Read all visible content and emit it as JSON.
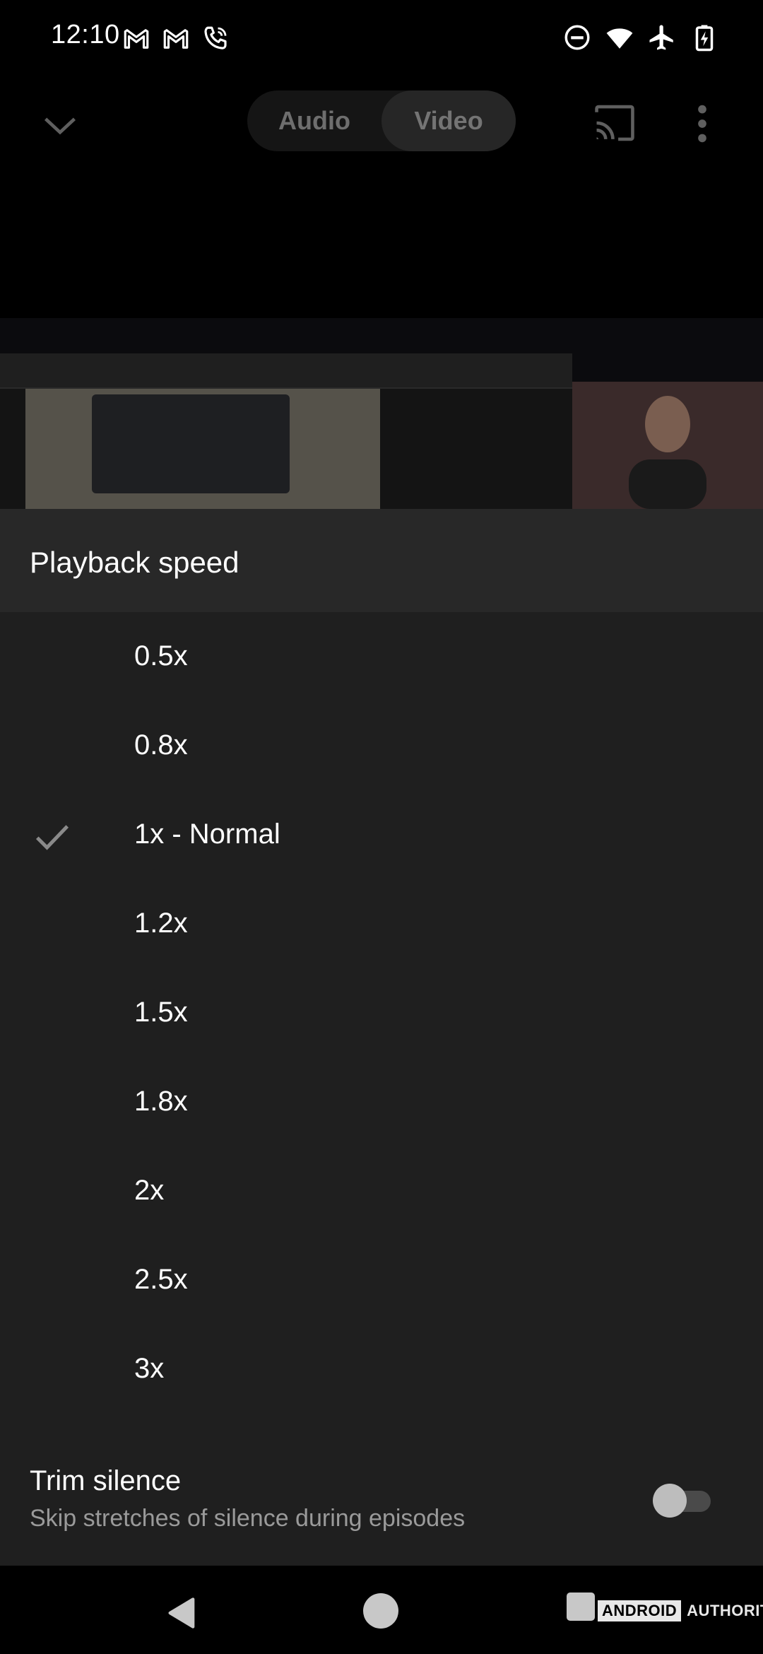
{
  "status_bar": {
    "time": "12:10",
    "left_icons": [
      "gmail-icon",
      "gmail-icon",
      "wifi-calling-icon"
    ],
    "right_icons": [
      "do-not-disturb-icon",
      "wifi-icon",
      "airplane-mode-icon",
      "battery-charging-icon"
    ]
  },
  "top_bar": {
    "collapse_icon": "chevron-down-icon",
    "tabs": [
      {
        "label": "Audio",
        "selected": false
      },
      {
        "label": "Video",
        "selected": true
      }
    ],
    "cast_icon": "cast-icon",
    "more_icon": "more-vert-icon"
  },
  "sheet": {
    "title": "Playback speed",
    "speeds": [
      {
        "label": "0.5x",
        "selected": false
      },
      {
        "label": "0.8x",
        "selected": false
      },
      {
        "label": "1x - Normal",
        "selected": true
      },
      {
        "label": "1.2x",
        "selected": false
      },
      {
        "label": "1.5x",
        "selected": false
      },
      {
        "label": "1.8x",
        "selected": false
      },
      {
        "label": "2x",
        "selected": false
      },
      {
        "label": "2.5x",
        "selected": false
      },
      {
        "label": "3x",
        "selected": false
      }
    ],
    "trim_silence": {
      "title": "Trim silence",
      "subtitle": "Skip stretches of silence during episodes",
      "enabled": false
    }
  },
  "nav_bar": {
    "icons": [
      "back-icon",
      "home-icon",
      "recents-icon"
    ]
  },
  "watermark": {
    "brand": "ANDROID",
    "suffix": "AUTHORITY"
  },
  "colors": {
    "sheet_bg": "#1f1f1f",
    "header_bg": "#282828",
    "text_primary": "#ffffff",
    "text_secondary": "#9a9a9a",
    "check": "#8a8a8a"
  }
}
